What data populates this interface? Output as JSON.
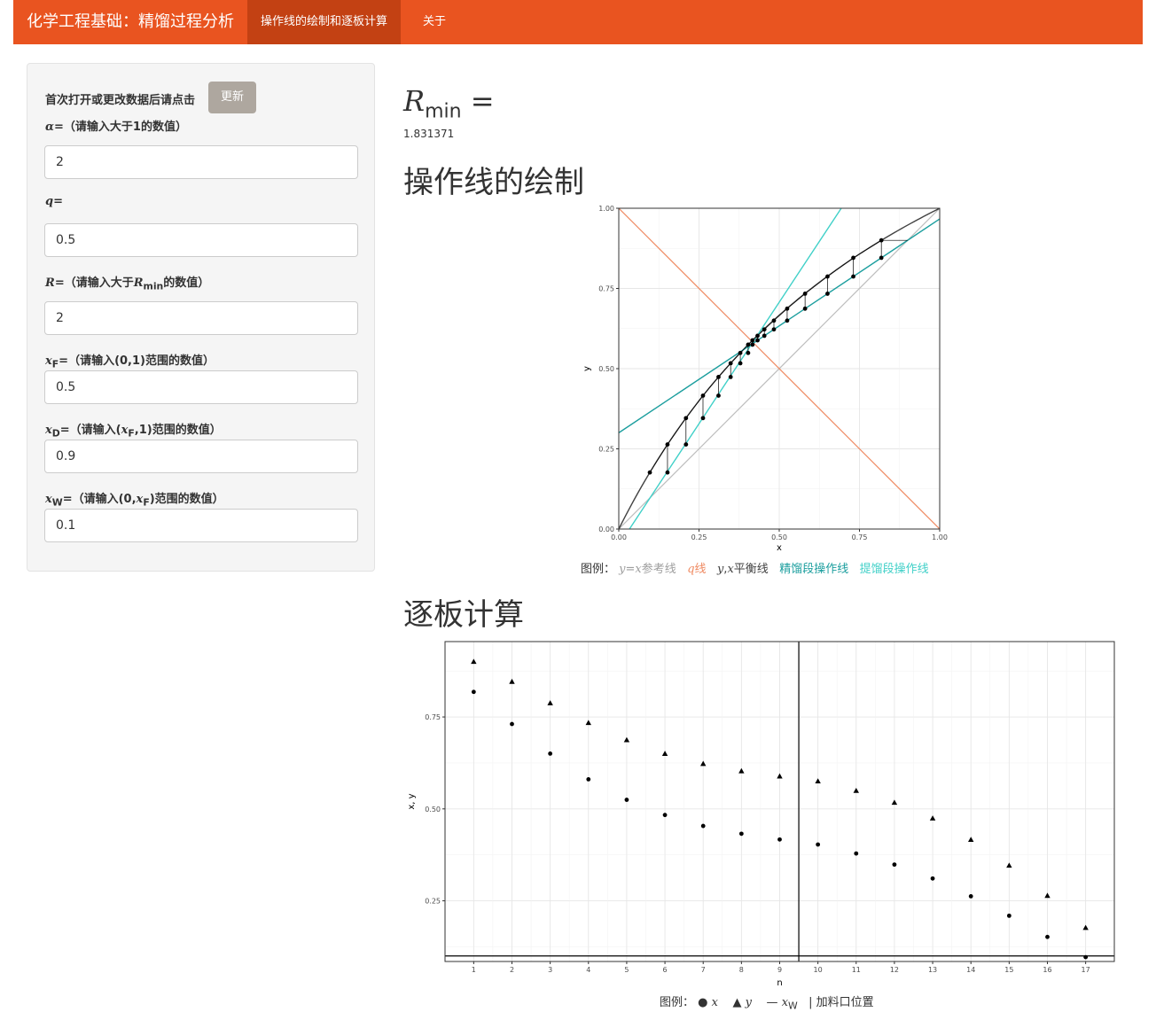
{
  "navbar": {
    "brand": "化学工程基础：精馏过程分析",
    "tabs": [
      "操作线的绘制和逐板计算",
      "关于"
    ]
  },
  "sidebar": {
    "update_prompt": "首次打开或更改数据后请点击",
    "update_button": "更新",
    "alpha_label": "α",
    "alpha_hint": "=（请输入大于1的数值）",
    "alpha_value": "2",
    "q_label": "q",
    "q_hint": "=",
    "q_value": "0.5",
    "R_label": "R",
    "R_hint_pre": "=（请输入大于",
    "R_hint_R": "R",
    "R_hint_sub": "min",
    "R_hint_post": "的数值）",
    "R_value": "2",
    "xF_label": "x",
    "xF_sub": "F",
    "xF_hint": "=（请输入(0,1)范围的数值）",
    "xF_value": "0.5",
    "xD_label": "x",
    "xD_sub": "D",
    "xD_hint_pre": "=（请输入(",
    "xD_hint_x": "x",
    "xD_hint_sub": "F",
    "xD_hint_post": ",1)范围的数值）",
    "xD_value": "0.9",
    "xW_label": "x",
    "xW_sub": "W",
    "xW_hint_pre": "=（请输入(0,",
    "xW_hint_x": "x",
    "xW_hint_sub": "F",
    "xW_hint_post": ")范围的数值）",
    "xW_value": "0.1"
  },
  "main": {
    "rmin_R": "R",
    "rmin_sub": "min",
    "rmin_eq": " =",
    "rmin_value": "1.831371",
    "h_operating": "操作线的绘制",
    "h_stepwise": "逐板计算",
    "legend1": {
      "prefix": "图例：",
      "ref": "y=x参考线",
      "q": "q线",
      "eq": "y,x平衡线",
      "rect": "精馏段操作线",
      "strip": "提馏段操作线"
    },
    "legend2": {
      "prefix": "图例：",
      "x": "● x",
      "y": "▲ y",
      "xw": "— x",
      "xw_sub": "W",
      "feed": "| 加料口位置"
    }
  },
  "colors": {
    "navbar": "#e95420",
    "ref_line": "#bdbdbd",
    "q_line": "#ef8a62",
    "eq_line": "#424242",
    "rect_line": "#1b9e9e",
    "strip_line": "#40d0c8"
  },
  "chart_data": [
    {
      "type": "line",
      "xlabel": "x",
      "ylabel": "y",
      "xlim": [
        0,
        1
      ],
      "ylim": [
        0,
        1
      ],
      "xticks": [
        "0.00",
        "0.25",
        "0.50",
        "0.75",
        "1.00"
      ],
      "yticks": [
        "0.00",
        "0.25",
        "0.50",
        "0.75",
        "1.00"
      ],
      "alpha": 2,
      "q": 0.5,
      "R": 2,
      "xF": 0.5,
      "xD": 0.9,
      "xW": 0.1,
      "series": [
        {
          "name": "y=x参考线",
          "x": [
            0,
            1
          ],
          "y": [
            0,
            1
          ]
        },
        {
          "name": "q线",
          "x": [
            0,
            1
          ],
          "y": [
            1,
            0
          ]
        },
        {
          "name": "y,x平衡线",
          "equation": "y = 2x/(1+x)"
        },
        {
          "name": "精馏段操作线",
          "x": [
            0,
            1
          ],
          "y": [
            0.3,
            0.9667
          ]
        },
        {
          "name": "提馏段操作线",
          "x": [
            0.0333,
            0.6933
          ],
          "y": [
            0,
            1
          ]
        }
      ],
      "stage_points": {
        "x": [
          0.8182,
          0.7308,
          0.6504,
          0.5805,
          0.5247,
          0.4834,
          0.4536,
          0.4324,
          0.4167,
          0.4031,
          0.3787,
          0.3486,
          0.3107,
          0.2624,
          0.2094,
          0.1518,
          0.0968
        ],
        "y": [
          0.9,
          0.8455,
          0.7872,
          0.7336,
          0.687,
          0.6498,
          0.6223,
          0.6024,
          0.5883,
          0.5748,
          0.549,
          0.5167,
          0.474,
          0.4158,
          0.3457,
          0.2636,
          0.1764
        ]
      }
    },
    {
      "type": "scatter",
      "xlabel": "n",
      "ylabel": "x, y",
      "xlim": [
        0.25,
        17.75
      ],
      "ylim": [
        0.085,
        0.955
      ],
      "categories": [
        "1",
        "2",
        "3",
        "4",
        "5",
        "6",
        "7",
        "8",
        "9",
        "10",
        "11",
        "12",
        "13",
        "14",
        "15",
        "16",
        "17"
      ],
      "yticks": [
        "0.25",
        "0.50",
        "0.75"
      ],
      "series": [
        {
          "name": "x",
          "values": [
            0.8182,
            0.7308,
            0.6504,
            0.5805,
            0.5247,
            0.4834,
            0.4536,
            0.4324,
            0.4167,
            0.4031,
            0.3787,
            0.3486,
            0.3107,
            0.2624,
            0.2094,
            0.1518,
            0.0968
          ]
        },
        {
          "name": "y",
          "values": [
            0.9,
            0.8455,
            0.7872,
            0.7336,
            0.687,
            0.6498,
            0.6223,
            0.6024,
            0.5883,
            0.5748,
            0.549,
            0.5167,
            0.474,
            0.4158,
            0.3457,
            0.2636,
            0.1764
          ]
        }
      ],
      "xW_line": 0.1,
      "feed_stage_line": 9.5
    }
  ]
}
